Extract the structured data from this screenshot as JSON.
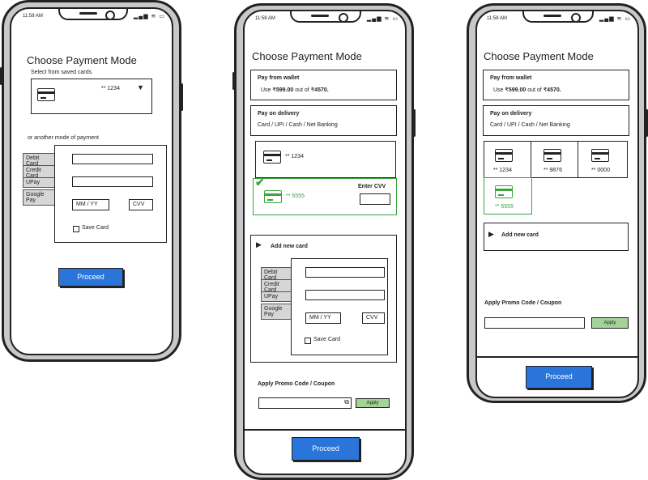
{
  "status": {
    "time": "11:58 AM",
    "icons": "▂▄▆ ≋ ▭"
  },
  "phone1": {
    "title": "Choose Payment Mode",
    "saved_label": "Select from saved cards",
    "saved_card": "** 1234",
    "another_label": "or another mode of payment",
    "methods": [
      "Debit Card",
      "Credit Card",
      "UPay",
      "Google Pay"
    ],
    "mm_yy": "MM / YY",
    "cvv": "CVV",
    "save_card": "Save Card",
    "proceed": "Proceed"
  },
  "phone2": {
    "title": "Choose Payment Mode",
    "wallet_title": "Pay from wallet",
    "wallet_desc": "Use ",
    "wallet_amount": "599.00",
    "wallet_mid": " out of ",
    "wallet_total": "4570.",
    "delivery_title": "Pay on delivery",
    "delivery_desc": "Card / UPI / Cash / Net Banking",
    "card1": "** 1234",
    "card2": "** 5555",
    "enter_cvv": "Enter CVV",
    "add_card": "Add new card",
    "methods": [
      "Debit Card",
      "Credit Card",
      "UPay",
      "Google Pay"
    ],
    "mm_yy": "MM / YY",
    "cvv": "CVV",
    "save_card": "Save Card",
    "promo_title": "Apply Promo Code / Coupon",
    "apply": "Apply",
    "proceed": "Proceed"
  },
  "phone3": {
    "title": "Choose Payment Mode",
    "wallet_title": "Pay from wallet",
    "wallet_desc": "Use ",
    "wallet_amount": "599.00",
    "wallet_mid": " out of ",
    "wallet_total": "4570.",
    "delivery_title": "Pay on delivery",
    "delivery_desc": "Card / UPI / Cash / Net Banking",
    "cards": [
      "** 1234",
      "** 9876",
      "** 0000",
      "** 5555"
    ],
    "add_card": "Add new card",
    "promo_title": "Apply Promo Code / Coupon",
    "apply": "Apply",
    "proceed": "Proceed"
  },
  "colors": {
    "primary": "#2a75d9",
    "selected": "#3aa33a",
    "apply": "#a4d39a",
    "tab": "#d6d6d6"
  }
}
